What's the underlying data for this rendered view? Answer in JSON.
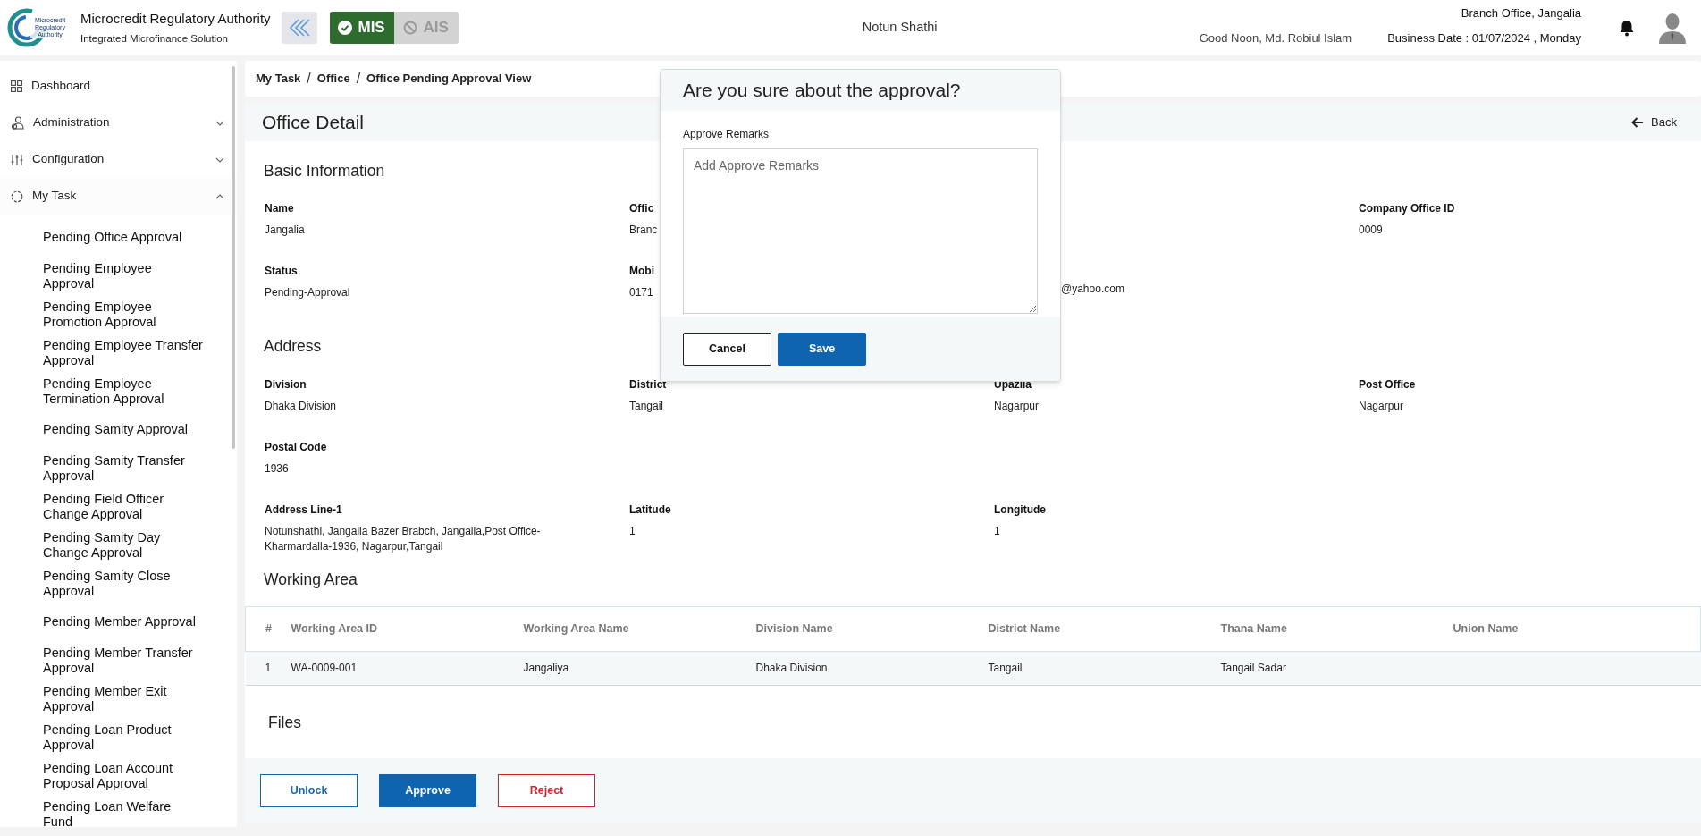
{
  "header": {
    "org_name": "Microcredit Regulatory Authority",
    "org_subtitle": "Integrated Microfinance Solution",
    "logo_text": "Microcredit Regulatory Authority",
    "modules": [
      {
        "label": "MIS",
        "selected": true
      },
      {
        "label": "AIS",
        "selected": false
      }
    ],
    "center_title": "Notun Shathi",
    "greeting": "Good Noon, Md. Robiul Islam",
    "branch": "Branch Office, Jangalia",
    "business_date": "Business Date : 01/07/2024 , Monday"
  },
  "sidebar": {
    "items": [
      {
        "label": "Dashboard",
        "kind": "link"
      },
      {
        "label": "Administration",
        "kind": "group",
        "expanded": false
      },
      {
        "label": "Configuration",
        "kind": "group",
        "expanded": false
      },
      {
        "label": "My Task",
        "kind": "group",
        "expanded": true,
        "children": [
          {
            "label": "Pending Office Approval"
          },
          {
            "label": "Pending Employee Approval"
          },
          {
            "label": "Pending Employee Promotion Approval"
          },
          {
            "label": "Pending Employee Transfer Approval"
          },
          {
            "label": "Pending Employee Termination Approval"
          },
          {
            "label": "Pending Samity Approval"
          },
          {
            "label": "Pending Samity Transfer Approval"
          },
          {
            "label": "Pending Field Officer Change Approval"
          },
          {
            "label": "Pending Samity Day Change Approval"
          },
          {
            "label": "Pending Samity Close Approval"
          },
          {
            "label": "Pending Member Approval"
          },
          {
            "label": "Pending Member Transfer Approval"
          },
          {
            "label": "Pending Member Exit Approval"
          },
          {
            "label": "Pending Loan Product Approval"
          },
          {
            "label": "Pending Loan Account Proposal Approval"
          },
          {
            "label": "Pending Loan Welfare Fund"
          }
        ]
      }
    ]
  },
  "breadcrumb": [
    "My Task",
    "Office",
    "Office Pending Approval View"
  ],
  "breadcrumb_separators": [
    "/",
    "/"
  ],
  "page_title": "Office Detail",
  "back_label": "Back",
  "sections": [
    {
      "title": "Basic Information",
      "rows": [
        [
          {
            "label": "Name",
            "value": "Jangalia"
          },
          {
            "label": "Offic",
            "value": "Branc"
          },
          {},
          {
            "label": "Company Office ID",
            "value": "0009"
          }
        ],
        [
          {
            "label": "Status",
            "value": "Pending-Approval"
          },
          {
            "label": "Mobi",
            "value": "0171"
          },
          {
            "value": "@yahoo.com"
          },
          {}
        ]
      ]
    },
    {
      "title": "Address",
      "rows": [
        [
          {
            "label": "Division",
            "value": "Dhaka Division"
          },
          {
            "label": "District",
            "value": "Tangail"
          },
          {
            "label": "Upazila",
            "value": "Nagarpur"
          },
          {
            "label": "Post Office",
            "value": "Nagarpur"
          }
        ],
        [
          {
            "label": "Postal Code",
            "value": "1936"
          }
        ],
        [
          {
            "label": "Address Line-1",
            "value": "Notunshathi, Jangalia Bazer Brabch, Jangalia,Post Office-Kharmardalla-1936, Nagarpur,Tangail"
          },
          {
            "label": "Latitude",
            "value": "1"
          },
          {
            "label": "Longitude",
            "value": "1"
          }
        ]
      ]
    }
  ],
  "working_area": {
    "title": "Working Area",
    "columns": [
      "#",
      "Working Area ID",
      "Working Area Name",
      "Division Name",
      "District Name",
      "Thana Name",
      "Union Name"
    ],
    "rows": [
      [
        "1",
        "WA-0009-001",
        "Jangaliya",
        "Dhaka Division",
        "Tangail",
        "Tangail Sadar"
      ]
    ]
  },
  "files_title": "Files",
  "actions": [
    {
      "label": "Unlock",
      "kind": "outline"
    },
    {
      "label": "Approve",
      "kind": "primary"
    },
    {
      "label": "Reject",
      "kind": "danger"
    }
  ],
  "modal": {
    "title": "Are you sure about the approval?",
    "field_label": "Approve Remarks",
    "placeholder": "Add Approve Remarks",
    "buttons": [
      {
        "label": "Cancel",
        "kind": "secondary"
      },
      {
        "label": "Save",
        "kind": "primary"
      }
    ]
  }
}
